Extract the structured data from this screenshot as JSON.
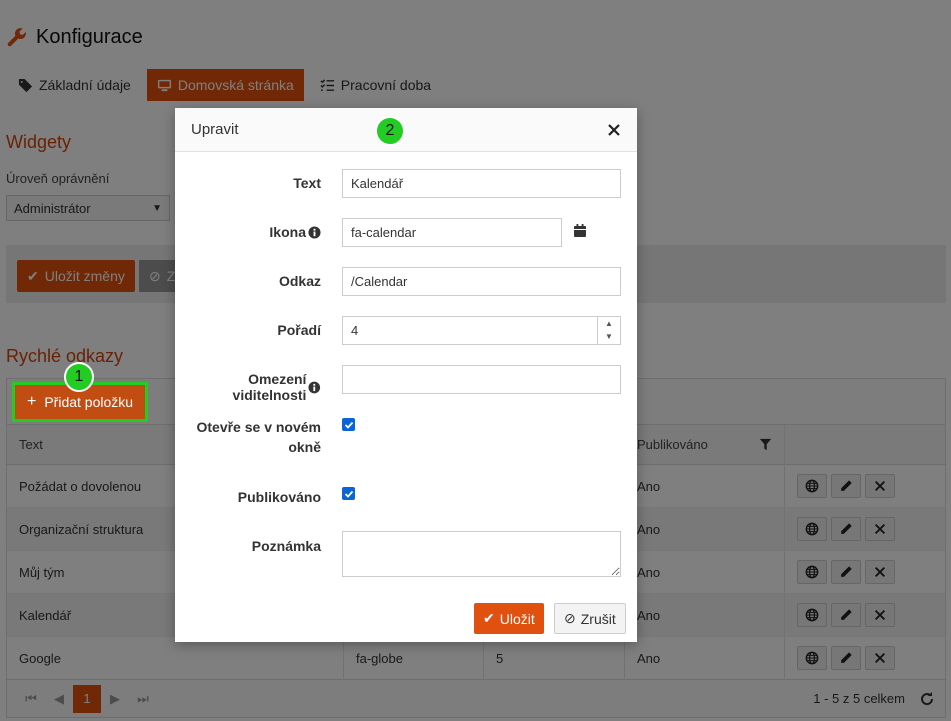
{
  "page": {
    "title": "Konfigurace",
    "tabs": [
      {
        "label": "Základní údaje",
        "icon": "tags-icon"
      },
      {
        "label": "Domovská stránka",
        "icon": "monitor-icon",
        "active": true
      },
      {
        "label": "Pracovní doba",
        "icon": "list-check-icon"
      }
    ],
    "widgets_title": "Widgety",
    "permission_label": "Úroveň oprávnění",
    "permission_value": "Administrátor",
    "save_changes_label": "Uložit změny",
    "cancel_changes_label": "Z",
    "quick_links_title": "Rychlé odkazy",
    "add_item_label": "Přidat položku",
    "accent_color": "#e0500f"
  },
  "grid": {
    "columns": [
      "Text",
      "",
      "",
      "Publikováno",
      ""
    ],
    "rows": [
      {
        "text": "Požádat o dovolenou",
        "icon": "",
        "order": "",
        "published": "Ano"
      },
      {
        "text": "Organizační struktura",
        "icon": "",
        "order": "",
        "published": "Ano"
      },
      {
        "text": "Můj tým",
        "icon": "",
        "order": "",
        "published": "Ano"
      },
      {
        "text": "Kalendář",
        "icon": "",
        "order": "",
        "published": "Ano"
      },
      {
        "text": "Google",
        "icon": "fa-globe",
        "order": "5",
        "published": "Ano"
      }
    ],
    "current_page": "1",
    "page_info": "1 - 5 z 5 celkem"
  },
  "markers": {
    "one": "1",
    "two": "2"
  },
  "dialog": {
    "title": "Upravit",
    "fields": {
      "text_label": "Text",
      "text_value": "Kalendář",
      "icon_label": "Ikona",
      "icon_value": "fa-calendar",
      "link_label": "Odkaz",
      "link_value": "/Calendar",
      "order_label": "Pořadí",
      "order_value": "4",
      "visibility_label": "Omezení viditelnosti",
      "visibility_value": "",
      "new_window_label_line1": "Otevře se v novém",
      "new_window_label_line2": "okně",
      "new_window_checked": true,
      "published_label": "Publikováno",
      "published_checked": true,
      "note_label": "Poznámka",
      "note_value": ""
    },
    "save_label": "Uložit",
    "cancel_label": "Zrušit"
  }
}
